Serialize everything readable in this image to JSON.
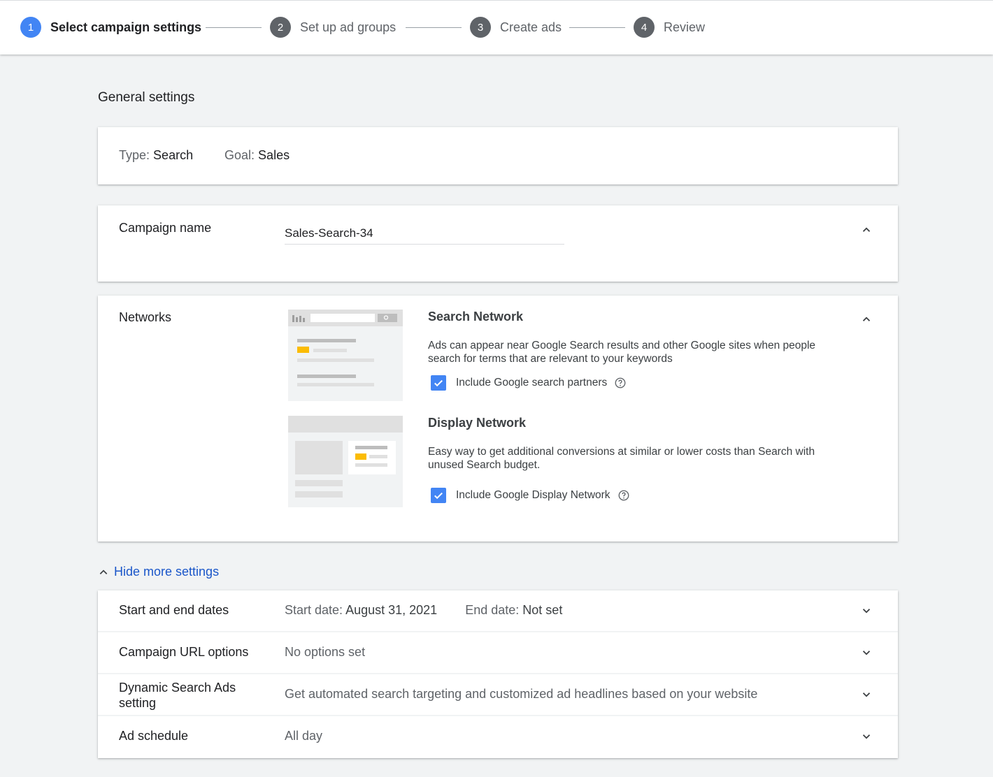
{
  "stepper": {
    "steps": [
      {
        "num": "1",
        "label": "Select campaign settings"
      },
      {
        "num": "2",
        "label": "Set up ad groups"
      },
      {
        "num": "3",
        "label": "Create ads"
      },
      {
        "num": "4",
        "label": "Review"
      }
    ],
    "active_step": 1
  },
  "general_settings_title": "General settings",
  "summary": {
    "type_label": "Type:",
    "type_value": "Search",
    "goal_label": "Goal:",
    "goal_value": "Sales"
  },
  "campaign_name": {
    "label": "Campaign name",
    "value": "Sales-Search-34"
  },
  "networks": {
    "label": "Networks",
    "search": {
      "title": "Search Network",
      "description": "Ads can appear near Google Search results and other Google sites when people search for terms that are relevant to your keywords",
      "checkbox_label": "Include Google search partners",
      "checked": true
    },
    "display": {
      "title": "Display Network",
      "description": "Easy way to get additional conversions at similar or lower costs than Search with unused Search budget.",
      "checkbox_label": "Include Google Display Network",
      "checked": true
    }
  },
  "more_settings_link": "Hide more settings",
  "more_settings": {
    "dates": {
      "label": "Start and end dates",
      "start_label": "Start date:",
      "start_value": "August 31, 2021",
      "end_label": "End date:",
      "end_value": "Not set"
    },
    "url_options": {
      "label": "Campaign URL options",
      "value": "No options set"
    },
    "dsa": {
      "label_line1": "Dynamic Search Ads",
      "label_line2": "setting",
      "value": "Get automated search targeting and customized ad headlines based on your website"
    },
    "schedule": {
      "label": "Ad schedule",
      "value": "All day"
    }
  },
  "colors": {
    "accent_blue": "#4285f4",
    "link_blue": "#1a56c9",
    "illustration_yellow": "#fbbc04"
  }
}
